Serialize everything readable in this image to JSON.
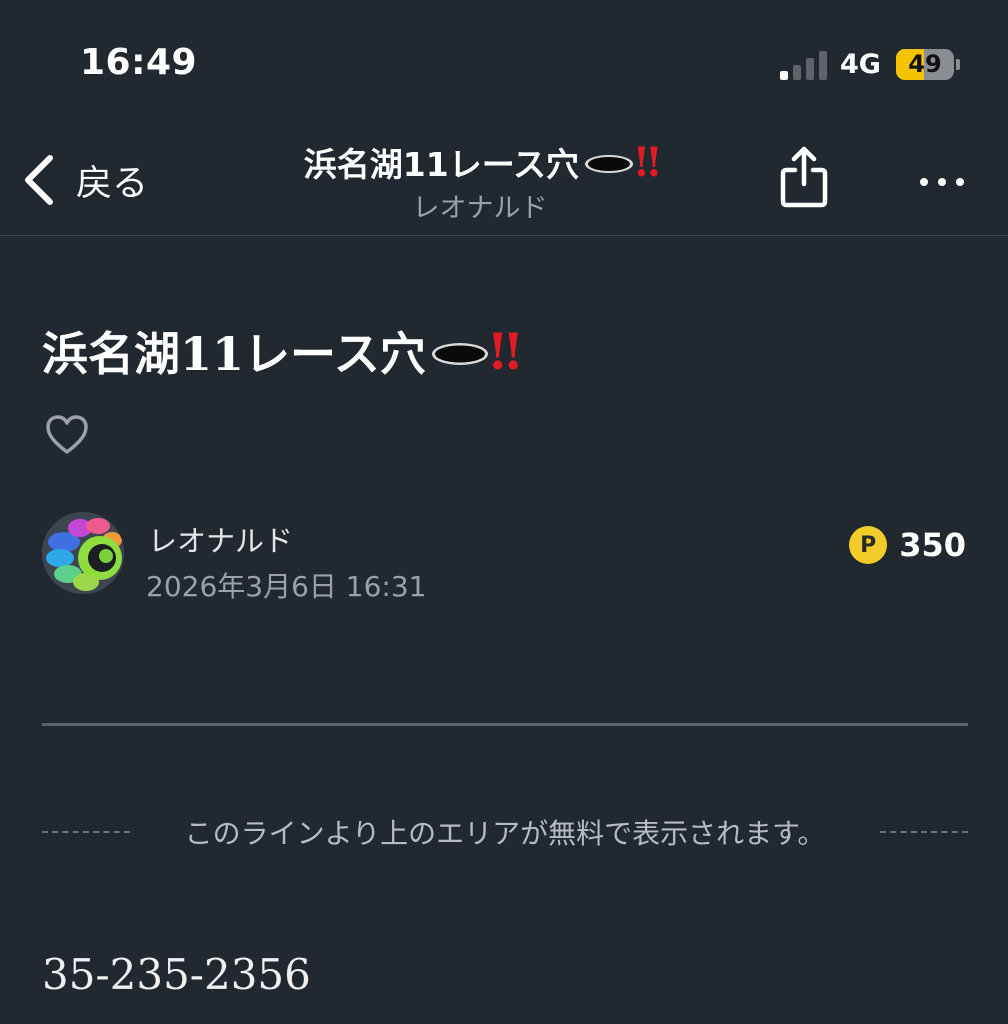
{
  "status_bar": {
    "time": "16:49",
    "network": "4G",
    "battery": "49",
    "battery_level": 0.49,
    "signal_bars_active": 1,
    "signal_bars_total": 4
  },
  "nav": {
    "back_label": "戻る",
    "title": "浜名湖11レース穴",
    "title_suffix": "‼",
    "subtitle": "レオナルド",
    "icons": [
      "chevron-left-icon",
      "share-icon",
      "more-icon"
    ]
  },
  "article": {
    "title": "浜名湖11レース穴",
    "title_suffix": "‼",
    "like_icon": "heart-icon",
    "author": "レオナルド",
    "date": "2026年3月6日 16:31",
    "points_icon_label": "P",
    "points": "350",
    "paywall_notice": "このラインより上のエリアが無料で表示されます。",
    "body": "35-235-2356"
  },
  "colors": {
    "background": "#212830",
    "accent_red": "#e01b24",
    "coin_yellow": "#f2cd2a",
    "battery_yellow": "#f5c400",
    "muted_text": "#9aa0a6"
  }
}
